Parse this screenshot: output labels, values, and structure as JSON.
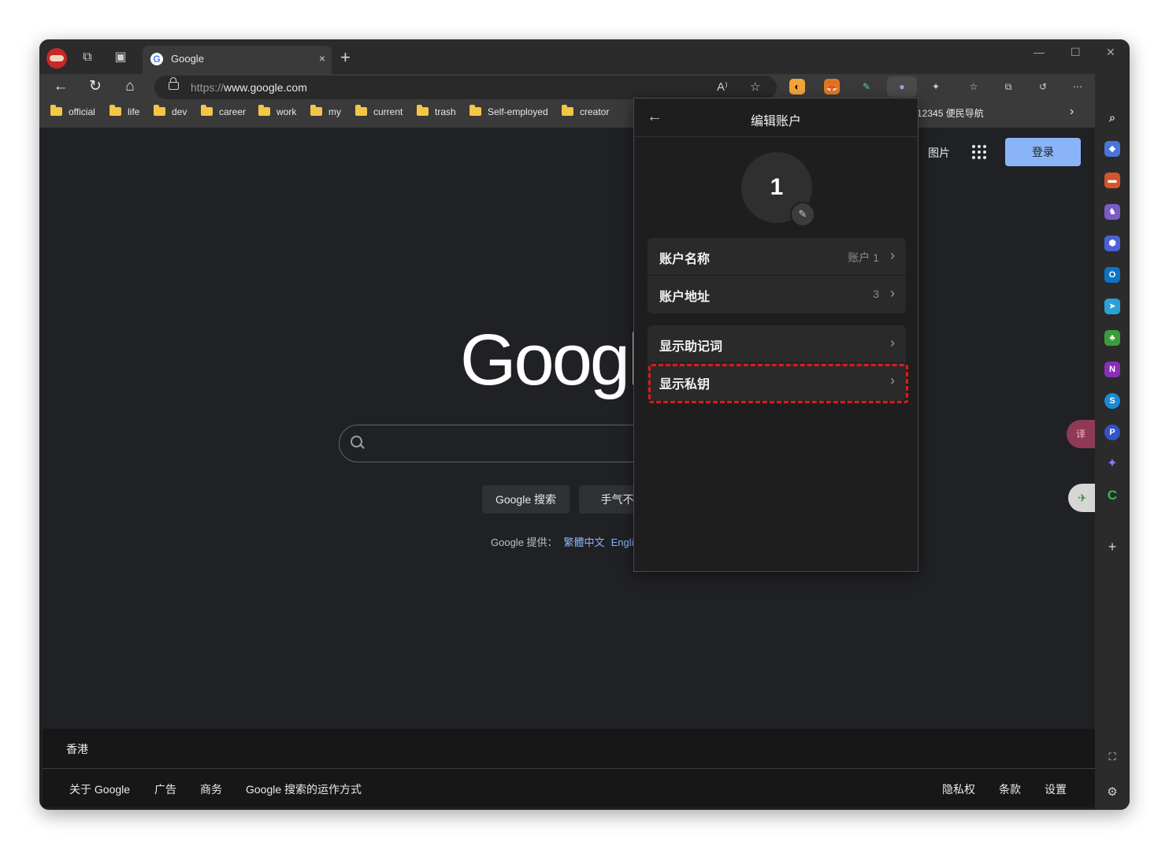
{
  "browser": {
    "tab": {
      "title": "Google",
      "favicon_letter": "G"
    },
    "url": {
      "scheme": "https://",
      "host": "www.google.com"
    },
    "new_tab_symbol": "+",
    "close_symbol": "×",
    "read_aloud": "A⁾"
  },
  "bookmarks": [
    "official",
    "life",
    "dev",
    "career",
    "work",
    "my",
    "current",
    "trash",
    "Self-employed",
    "creator"
  ],
  "bookmarks_overflow_text": "12345 便民导航",
  "google": {
    "logo_text": "Google",
    "images_link": "图片",
    "login_button": "登录",
    "search_button": "Google 搜索",
    "lucky_button": "手气不错",
    "offered_in": "Google 提供：",
    "lang_links": [
      "繁體中文",
      "English"
    ],
    "location": "香港",
    "footer_left": [
      "关于 Google",
      "广告",
      "商务",
      "Google 搜索的运作方式"
    ],
    "footer_right": [
      "隐私权",
      "条款",
      "设置"
    ]
  },
  "popup": {
    "title": "编辑账户",
    "avatar_text": "1",
    "rows": [
      {
        "label": "账户名称",
        "value": "账户 1"
      },
      {
        "label": "账户地址",
        "value": "3"
      },
      {
        "label": "显示助记词",
        "value": ""
      },
      {
        "label": "显示私钥",
        "value": ""
      }
    ],
    "highlight_color": "#e0181b"
  },
  "colors": {
    "accent": "#8ab4f8",
    "page_bg": "#202124"
  }
}
